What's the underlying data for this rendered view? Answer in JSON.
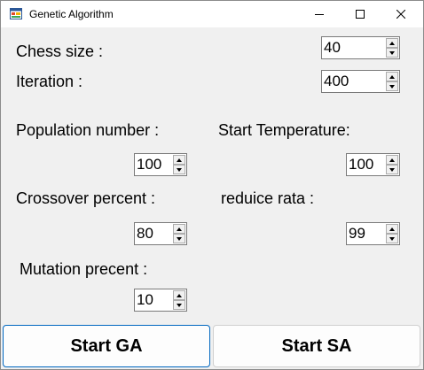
{
  "window": {
    "title": "Genetic Algorithm"
  },
  "fields": {
    "chess_size": {
      "label": "Chess size :",
      "value": "40"
    },
    "iteration": {
      "label": "Iteration :",
      "value": "400"
    },
    "population_number": {
      "label": "Population number :",
      "value": "100"
    },
    "start_temperature": {
      "label": "Start Temperature:",
      "value": "100"
    },
    "crossover_percent": {
      "label": "Crossover percent :",
      "value": "80"
    },
    "reduice_rata": {
      "label": "reduice rata :",
      "value": "99"
    },
    "mutation_precent": {
      "label": "Mutation precent :",
      "value": "10"
    }
  },
  "buttons": {
    "start_ga": "Start GA",
    "start_sa": "Start SA"
  },
  "icons": {
    "app": "app-window-icon",
    "minimize": "minimize-icon",
    "maximize": "maximize-icon",
    "close": "close-icon",
    "spin_up": "chevron-up-icon",
    "spin_down": "chevron-down-icon"
  },
  "colors": {
    "window_bg": "#f0f0f0",
    "focus_border": "#0067c0"
  }
}
